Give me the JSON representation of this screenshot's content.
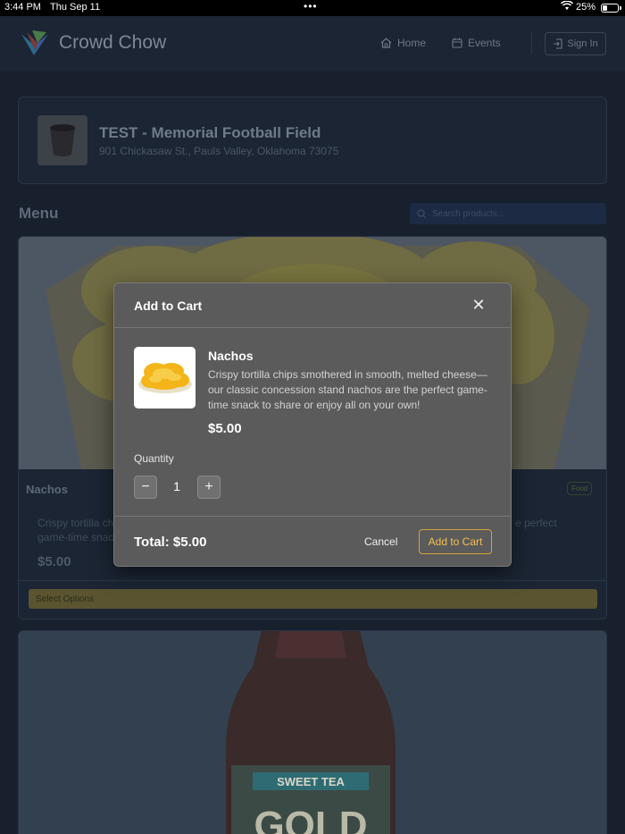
{
  "status_bar": {
    "time": "3:44 PM",
    "date": "Thu Sep 11",
    "battery": "25%"
  },
  "nav": {
    "brand": "Crowd Chow",
    "home": "Home",
    "events": "Events",
    "sign_in": "Sign In"
  },
  "venue": {
    "title": "TEST - Memorial Football Field",
    "address": "901 Chickasaw St., Pauls Valley, Oklahoma 73075"
  },
  "menu": {
    "title": "Menu",
    "search_placeholder": "Search products..."
  },
  "product": {
    "name": "Nachos",
    "badge": "Food",
    "description_line1": "Crispy tortilla ch",
    "description_line1_end": "e perfect",
    "description_line2": "game-time snac",
    "price": "$5.00",
    "select_label": "Select Options"
  },
  "product2": {
    "label_line1": "SWEET TEA",
    "label_line2": "GOLD"
  },
  "modal": {
    "title": "Add to Cart",
    "item_name": "Nachos",
    "item_description": "Crispy tortilla chips smothered in smooth, melted cheese—our classic concession stand nachos are the perfect game-time snack to share or enjoy all on your own!",
    "item_price": "$5.00",
    "quantity_label": "Quantity",
    "quantity": "1",
    "minus": "−",
    "plus": "+",
    "close": "✕",
    "total": "Total: $5.00",
    "cancel": "Cancel",
    "add_to_cart": "Add to Cart"
  },
  "colors": {
    "accent": "#f2c04f",
    "modal_bg": "#5b5b5b",
    "page_bg": "#17202c"
  }
}
